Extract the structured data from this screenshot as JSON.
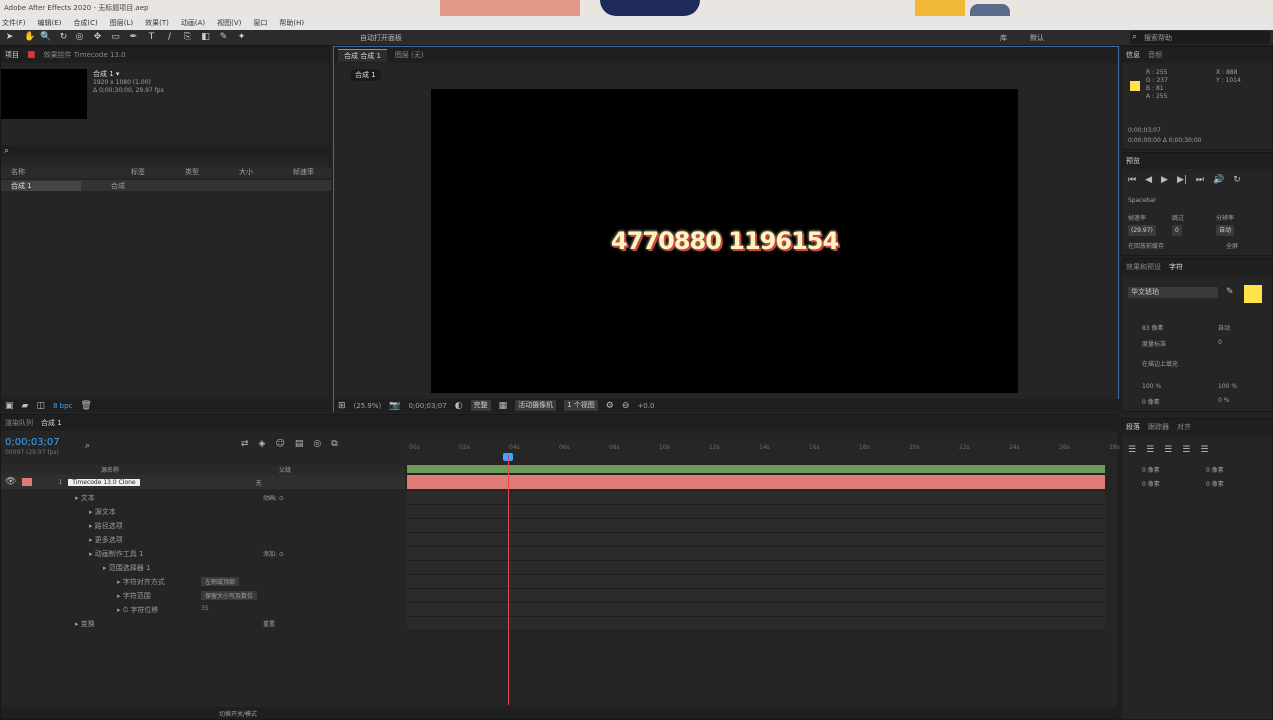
{
  "titlebar": {
    "text": "Adobe After Effects 2020 - 无标题项目.aep"
  },
  "menu": [
    "文件(F)",
    "编辑(E)",
    "合成(C)",
    "图层(L)",
    "效果(T)",
    "动画(A)",
    "视图(V)",
    "窗口",
    "帮助(H)"
  ],
  "toolbar": {
    "snap_label": "自动打开面板",
    "workspace": "默认",
    "search_placeholder": "搜索帮助",
    "lib": "库"
  },
  "project": {
    "tabs": [
      "项目",
      "效果控件 Timecode 13.0"
    ],
    "comp_name": "合成 1 ▾",
    "comp_info1": "1920 x 1080 (1.00)",
    "comp_info2": "Δ 0;00;30;00, 29.97 fps",
    "search_placeholder": "",
    "columns": [
      "名称",
      "标签",
      "类型",
      "大小",
      "帧速率"
    ],
    "items": [
      {
        "name": "合成 1",
        "type": "合成"
      }
    ],
    "bpc": "8 bpc"
  },
  "viewer": {
    "tabs": [
      "合成 合成 1",
      "图层 (无)"
    ],
    "breadcrumb": "合成 1",
    "display_text": "4770880 1196154",
    "zoom": "(25.9%)",
    "timecode": "0;00;03;07",
    "quality": "完整",
    "camera": "活动摄像机",
    "views": "1 个视图",
    "exposure": "+0.0"
  },
  "info": {
    "tabs": [
      "信息",
      "音频"
    ],
    "r": "R : 255",
    "g": "G : 237",
    "b": "B : 81",
    "a": "A : 255",
    "x": "X : 888",
    "y": "Y : 1014",
    "time1": "0;00;03;07",
    "time2": "0;00;00;00 Δ 0;00;30;00"
  },
  "preview": {
    "tab": "预览",
    "shortcut": "Spacebar",
    "include": "包含",
    "fps_label": "帧速率",
    "skip_label": "跳过",
    "res_label": "分辨率",
    "fps": "(29.97)",
    "skip": "0",
    "res": "自动",
    "cache": "在回放前缓存",
    "full": "全屏"
  },
  "character": {
    "tabs": [
      "效果和预设",
      "字符"
    ],
    "font": "华文琥珀",
    "size": "83 像素",
    "leading": "自动",
    "tracking": "0",
    "kerning": "度量标准",
    "stroke": "在描边上填充",
    "v_scale": "100 %",
    "h_scale": "100 %",
    "baseline": "0 像素",
    "tsume": "0 %",
    "fill_color": "#ffe24a"
  },
  "paragraph": {
    "tabs": [
      "段落",
      "跟踪器",
      "对齐"
    ],
    "indent1": "0 像素",
    "indent2": "0 像素",
    "indent3": "0 像素",
    "space1": "0 像素",
    "space2": "0 像素"
  },
  "timeline": {
    "tabs": [
      "渲染队列",
      "合成 1"
    ],
    "timecode": "0;00;03;07",
    "fps_sub": "00097 (29.97 fps)",
    "ruler": [
      "00s",
      "02s",
      "04s",
      "06s",
      "08s",
      "10s",
      "12s",
      "14s",
      "16s",
      "18s",
      "20s",
      "22s",
      "24s",
      "26s",
      "28s"
    ],
    "col_name": "源名称",
    "col_parent": "父级",
    "layer_num": "1",
    "layer_name": "Timecode 13.0 Clone",
    "layer_mode": "无",
    "props": [
      {
        "indent": 1,
        "label": "文本",
        "value": "动画: ⊙"
      },
      {
        "indent": 2,
        "label": "源文本",
        "value": ""
      },
      {
        "indent": 2,
        "label": "路径选项",
        "value": ""
      },
      {
        "indent": 2,
        "label": "更多选项",
        "value": ""
      },
      {
        "indent": 2,
        "label": "动画制作工具 1",
        "value": "添加: ⊙"
      },
      {
        "indent": 3,
        "label": "范围选择器 1",
        "value": ""
      },
      {
        "indent": 4,
        "label": "字符对齐方式",
        "value": "左侧或顶部"
      },
      {
        "indent": 4,
        "label": "字符范围",
        "value": "保留大小写及数位"
      },
      {
        "indent": 4,
        "label": "⏱ 字符位移",
        "value": "35"
      },
      {
        "indent": 1,
        "label": "变换",
        "value": "重置"
      }
    ],
    "footer": "切换开关/模式"
  },
  "colors": {
    "accent": "#3ca3ff",
    "layerbar": "#e07a76",
    "layerbar_top": "#6c9a5b",
    "playhead": "#e04a4a",
    "digits": "#fff3c0"
  }
}
